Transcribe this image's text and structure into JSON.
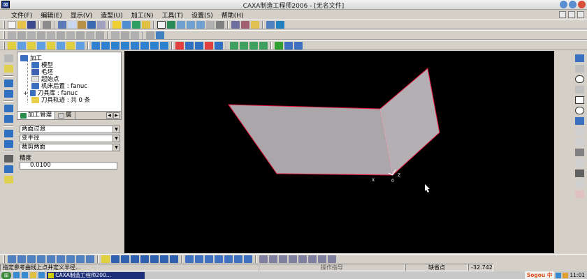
{
  "window": {
    "title": "CAXA制造工程师2006 - [无名文件]",
    "app_icon": "caxa-app-icon"
  },
  "menu": [
    {
      "label": "文件(F)"
    },
    {
      "label": "编辑(E)"
    },
    {
      "label": "显示(V)"
    },
    {
      "label": "造型(U)"
    },
    {
      "label": "加工(N)"
    },
    {
      "label": "工具(T)"
    },
    {
      "label": "设置(S)"
    },
    {
      "label": "帮助(H)"
    }
  ],
  "tree": {
    "root": "加工",
    "items": [
      {
        "label": "模型"
      },
      {
        "label": "毛坯"
      },
      {
        "label": "起始点"
      },
      {
        "label": "机床后置 : fanuc"
      },
      {
        "label": "刀具库 : fanuc"
      },
      {
        "label": "刀具轨迹 : 共 0 条"
      }
    ],
    "tabs": [
      {
        "label": "加工管理"
      },
      {
        "label": "属"
      }
    ]
  },
  "properties": {
    "dropdowns": [
      {
        "value": "两面过渡"
      },
      {
        "value": "变半径"
      },
      {
        "value": "裁剪两面"
      }
    ],
    "precision_label": "精度",
    "precision_value": "0.0100"
  },
  "viewport": {
    "background": "#000000",
    "surface_color": "#a9a5a8",
    "edge_color": "#e0103a",
    "axis_labels": {
      "x": "X",
      "z": "Z",
      "o": "0"
    }
  },
  "status": {
    "prompt": "指定参考曲线上点并定义半径...",
    "center": "操作指导",
    "mode": "缺省点",
    "coord": "-32.742"
  },
  "taskbar": {
    "task": "CAXA制造工程师200...",
    "tray_ime": "Sogou 中",
    "time": "11:01"
  }
}
